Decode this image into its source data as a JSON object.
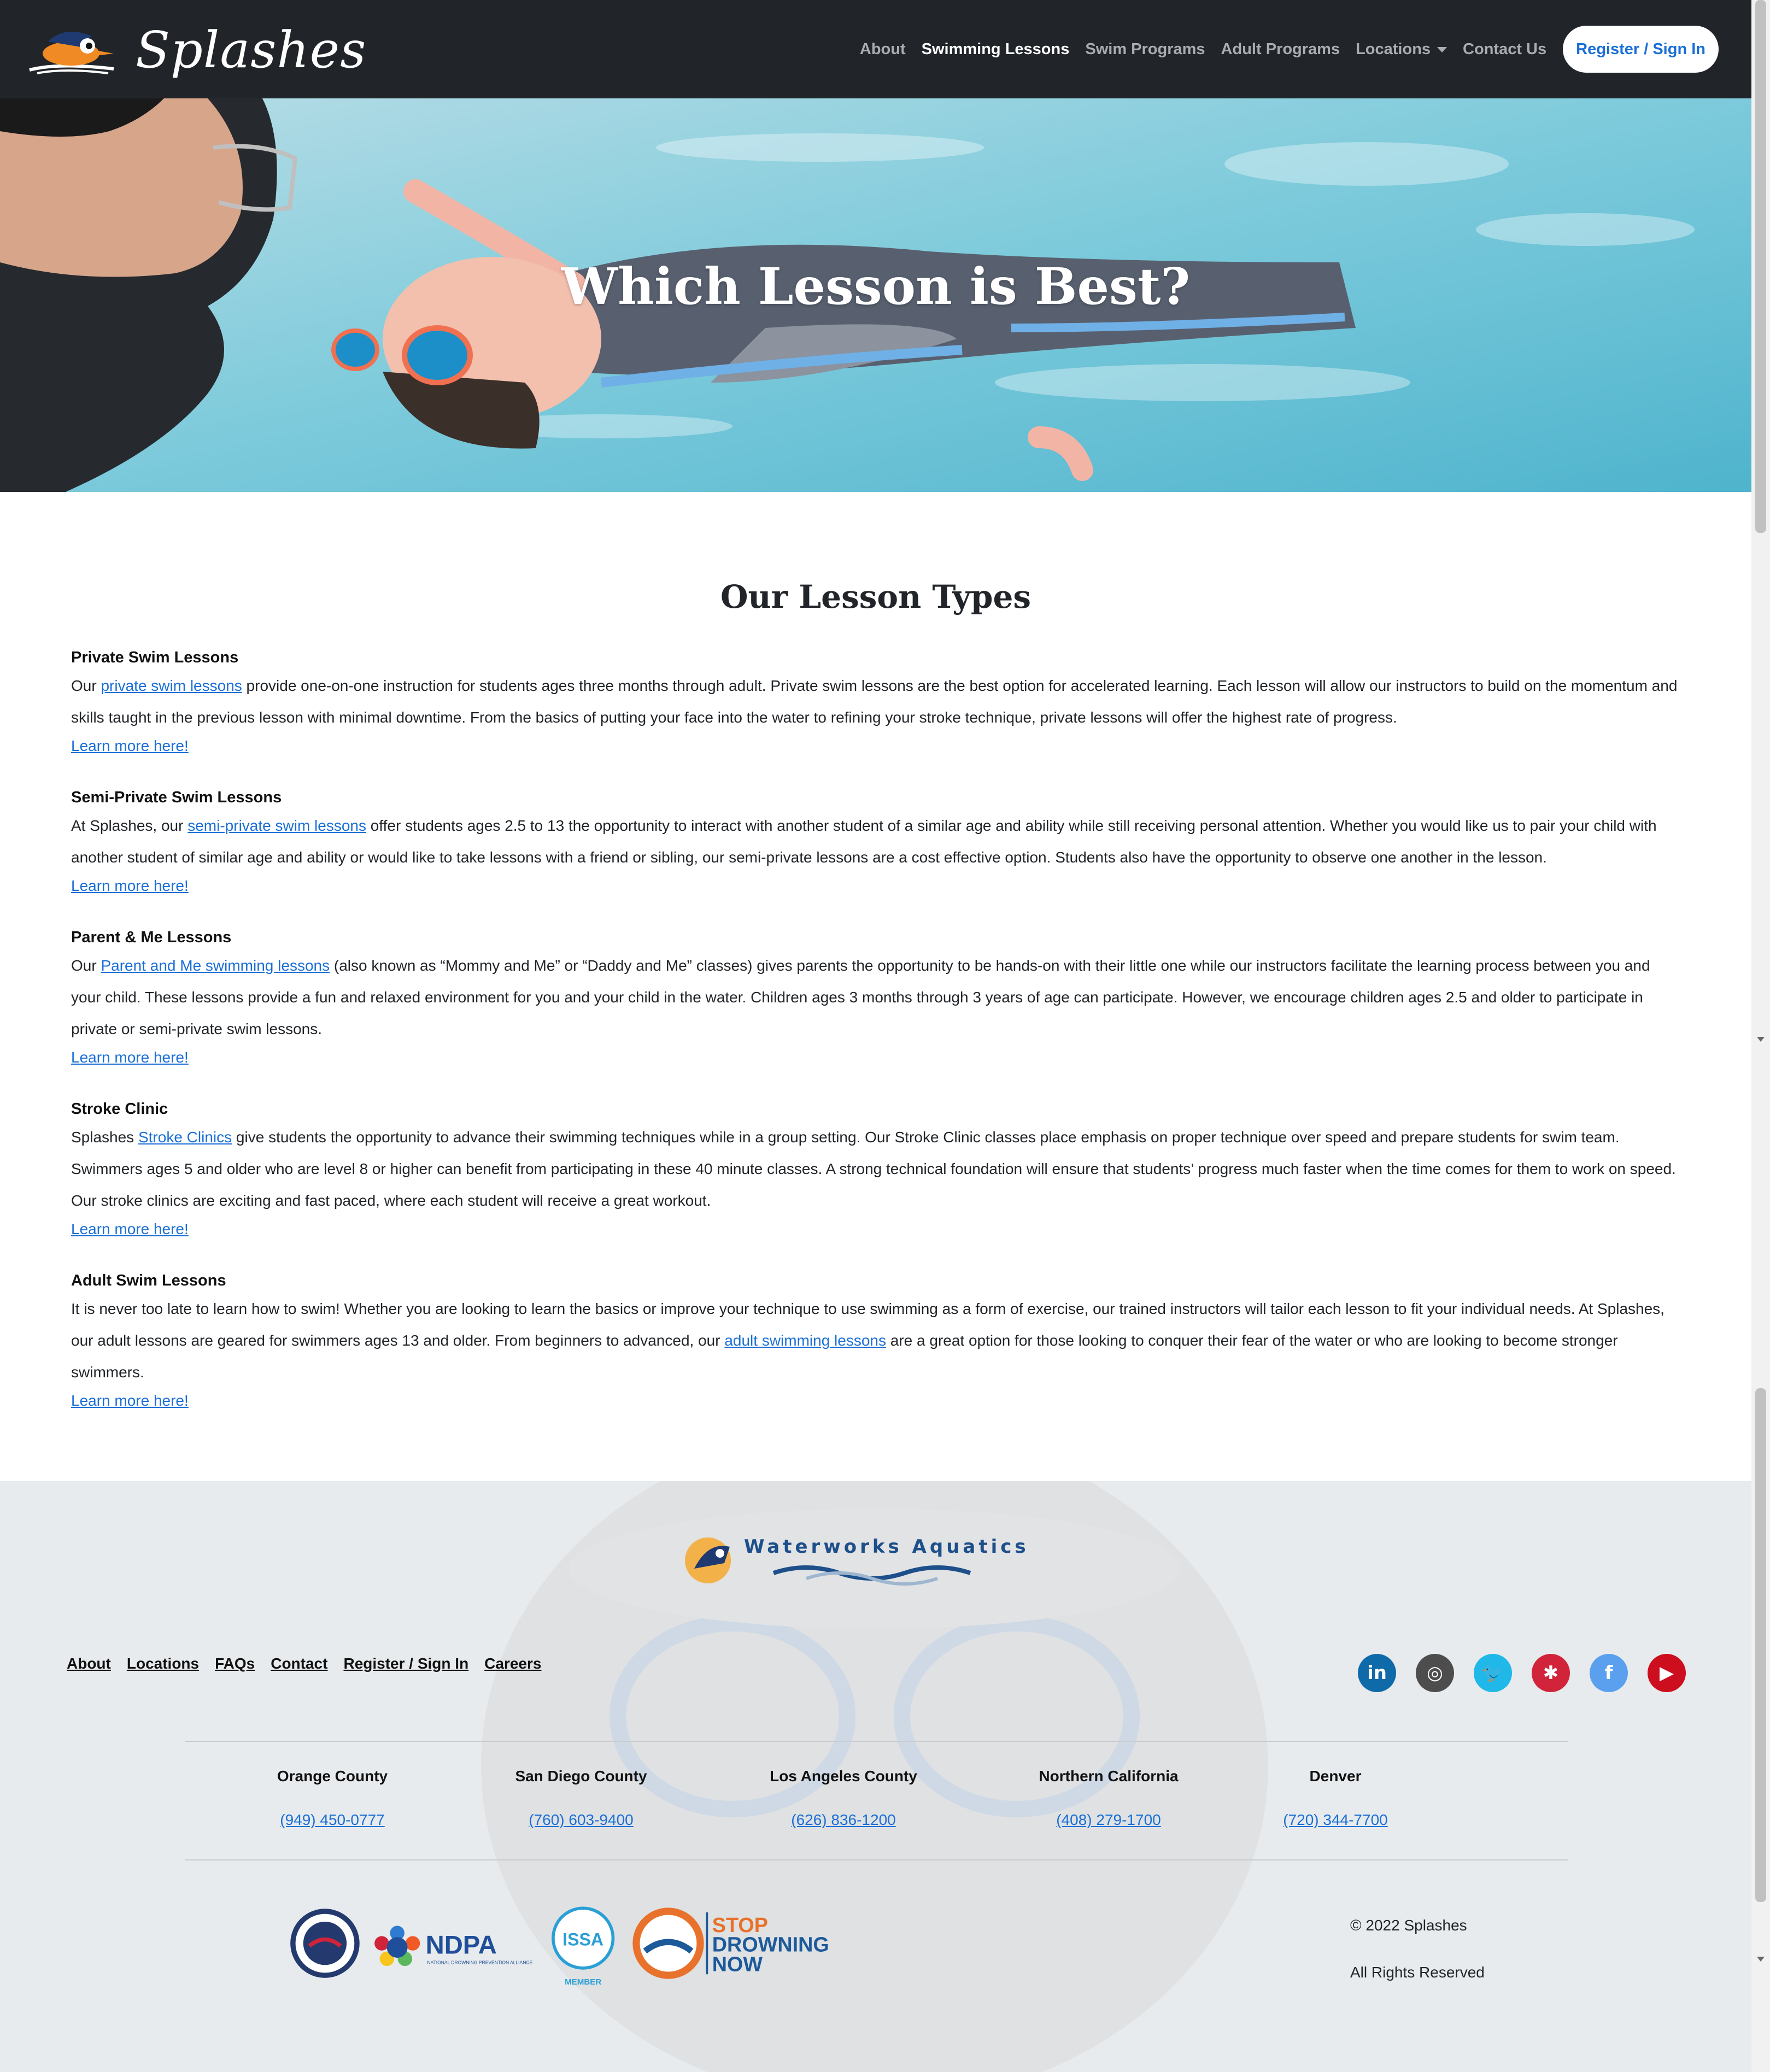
{
  "brand": {
    "name": "Splashes"
  },
  "nav": {
    "items": [
      "About",
      "Swimming Lessons",
      "Swim Programs",
      "Adult Programs",
      "Locations",
      "Contact Us"
    ],
    "active": "Swimming Lessons",
    "cta": "Register / Sign In"
  },
  "hero": {
    "title": "Which Lesson is Best?"
  },
  "main": {
    "title": "Our Lesson Types",
    "lessons": [
      {
        "title": "Private Swim Lessons",
        "pre": "Our ",
        "link": "private swim lessons",
        "post": " provide one-on-one instruction for students ages three months through adult. Private swim lessons are the best option for accelerated learning. Each lesson will allow our instructors to build on the momentum and skills taught in the previous lesson with minimal downtime. From the basics of putting your face into the water to refining your stroke technique, private lessons will offer the highest rate of progress.",
        "more": "Learn more here!"
      },
      {
        "title": "Semi-Private Swim Lessons",
        "pre": "At Splashes, our ",
        "link": "semi-private swim lessons",
        "post": " offer students ages 2.5 to 13 the opportunity to interact with another student of a similar age and ability while still receiving personal attention. Whether you would like us to pair your child with another student of similar age and ability or would like to take lessons with a friend or sibling, our semi-private lessons are a cost effective option. Students also have the opportunity to observe one another in the lesson.",
        "more": "Learn more here!"
      },
      {
        "title": "Parent & Me Lessons",
        "pre": "Our ",
        "link": "Parent and Me swimming lessons",
        "post": " (also known as “Mommy and Me” or “Daddy and Me” classes) gives parents the opportunity to be hands-on with their little one while our instructors facilitate the learning process between you and your child. These lessons provide a fun and relaxed environment for you and your child in the water. Children ages 3 months through 3 years of age can participate. However, we encourage children ages 2.5 and older to participate in private or semi-private swim lessons.",
        "more": "Learn more here!"
      },
      {
        "title": "Stroke Clinic",
        "pre": "Splashes ",
        "link": "Stroke Clinics",
        "post": " give students the opportunity to advance their swimming techniques while in a group setting. Our Stroke Clinic classes place emphasis on proper technique over speed and prepare students for swim team. Swimmers ages 5 and older who are level 8 or higher can benefit from participating in these 40 minute classes. A strong technical foundation will ensure that students’ progress much faster when the time comes for them to work on speed. Our stroke clinics are exciting and fast paced, where each student will receive a great workout.",
        "more": "Learn more here!"
      },
      {
        "title": "Adult Swim Lessons",
        "pre": "It is never too late to learn how to swim! Whether you are looking to learn the basics or improve your technique to use swimming as a form of exercise, our trained instructors will tailor each lesson to fit your individual needs. At Splashes, our adult lessons are geared for swimmers ages 13 and older. From beginners to advanced, our ",
        "link": "adult swimming lessons",
        "post": " are a great option for those looking to conquer their fear of the water or who are looking to become stronger swimmers.",
        "more": "Learn more here!"
      }
    ]
  },
  "footer": {
    "partner_logo": "Waterworks Aquatics",
    "links": [
      "About",
      "Locations",
      "FAQs",
      "Contact",
      "Register / Sign In",
      "Careers"
    ],
    "socials": [
      {
        "icon": "linkedin-icon",
        "glyph": "in",
        "color": "#0e6aa8"
      },
      {
        "icon": "instagram-icon",
        "glyph": "◎",
        "color": "#4d4d4d"
      },
      {
        "icon": "twitter-icon",
        "glyph": "🐦",
        "color": "#1fb8e8"
      },
      {
        "icon": "yelp-icon",
        "glyph": "✱",
        "color": "#d1243a"
      },
      {
        "icon": "facebook-icon",
        "glyph": "f",
        "color": "#5aa0ee"
      },
      {
        "icon": "youtube-icon",
        "glyph": "▶",
        "color": "#cc0e1e"
      }
    ],
    "counties": [
      {
        "name": "Orange County",
        "phone": "(949) 450-0777"
      },
      {
        "name": "San Diego County",
        "phone": "(760) 603-9400"
      },
      {
        "name": "Los Angeles County",
        "phone": "(626) 836-1200"
      },
      {
        "name": "Northern California",
        "phone": "(408) 279-1700"
      },
      {
        "name": "Denver",
        "phone": "(720) 344-7700"
      }
    ],
    "badges": {
      "ndpa": "NDPA",
      "ndpa_sub": "NATIONAL DROWNING PREVENTION ALLIANCE",
      "issa": "ISSA",
      "issa_member": "MEMBER",
      "stop1": "STOP",
      "stop2": "DROWNING",
      "stop3": "NOW"
    },
    "copyright": "© 2022 Splashes",
    "rights": "All Rights Reserved"
  },
  "colors": {
    "navbar": "#212529",
    "link": "#1a6fd6",
    "footer": "#e9ecee"
  }
}
